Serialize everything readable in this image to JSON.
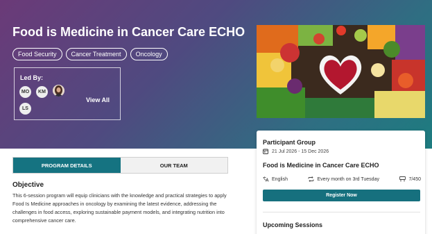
{
  "hero": {
    "title": "Food is Medicine in Cancer Care ECHO",
    "tags": [
      "Food Security",
      "Cancer Treatment",
      "Oncology"
    ],
    "led_by": {
      "label": "Led By:",
      "avatars": [
        "MO",
        "KM",
        "",
        "LS"
      ],
      "view_all": "View All"
    }
  },
  "participant_group": {
    "heading": "Participant Group",
    "date_icon": "calendar-icon",
    "dates": "21 Jul 2026 - 15 Dec 2026",
    "program": "Food is Medicine in Cancer Care ECHO",
    "language": "English",
    "frequency": "Every month on 3rd Tuesday",
    "capacity": "7/450",
    "register": "Register Now",
    "upcoming": "Upcoming Sessions"
  },
  "tabs": [
    "PROGRAM DETAILS",
    "OUR TEAM"
  ],
  "objective": {
    "heading": "Objective",
    "text": "This 6-session program will equip clinicians with the knowledge and practical strategies to apply Food Is Medicine approaches in oncology by examining the latest evidence, addressing the challenges in food access, exploring sustainable payment models, and integrating nutrition into comprehensive cancer care."
  },
  "colors": {
    "accent": "#157381",
    "hero_start": "#6b3a78",
    "hero_end": "#1d7c80"
  }
}
